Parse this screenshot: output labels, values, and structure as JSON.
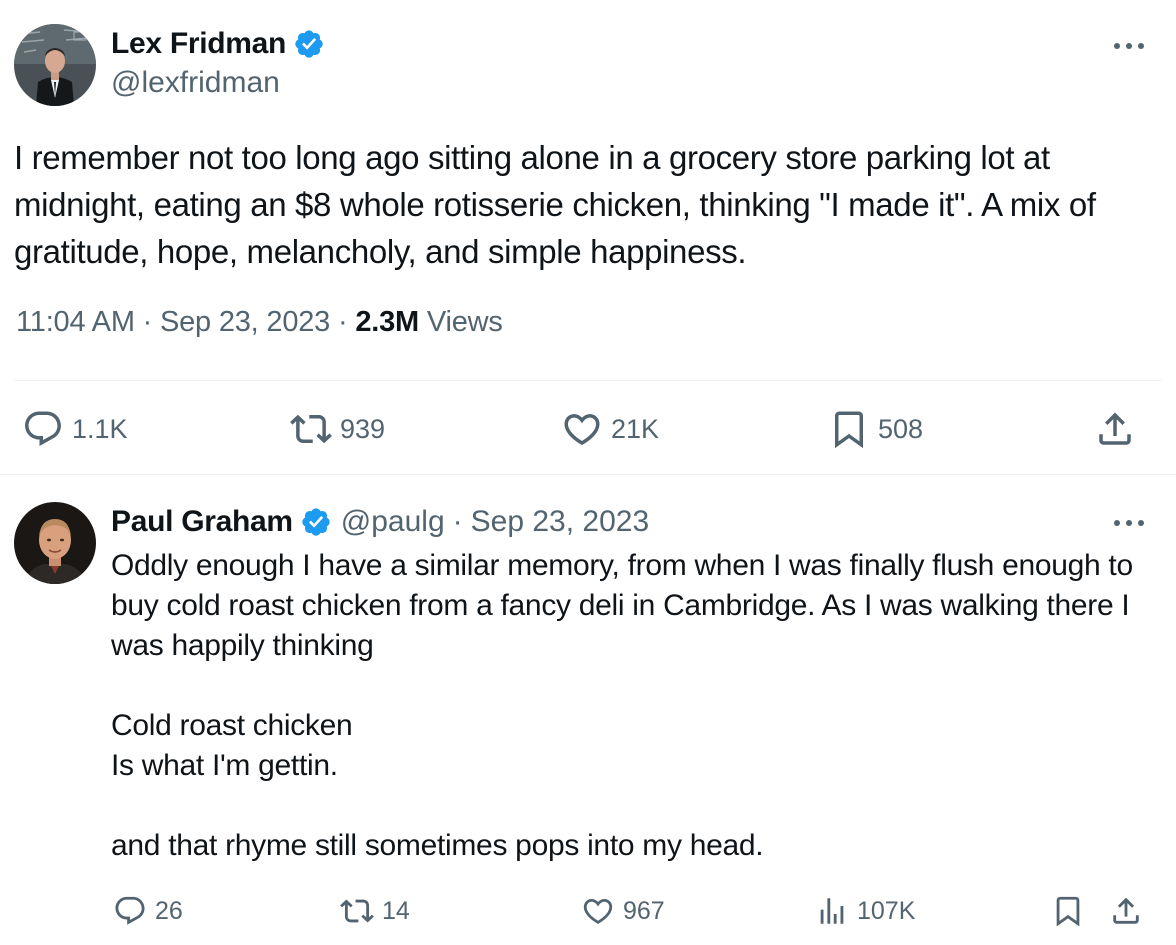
{
  "main_tweet": {
    "author": {
      "name": "Lex Fridman",
      "handle": "@lexfridman",
      "verified": true
    },
    "text": "I remember not too long ago sitting alone in a grocery store parking lot at midnight, eating an $8 whole rotisserie chicken, thinking \"I made it\". A mix of gratitude, hope, melancholy, and simple happiness.",
    "time": "11:04 AM",
    "date": "Sep 23, 2023",
    "views_count": "2.3M",
    "views_label": "Views",
    "separator": "·",
    "actions": {
      "replies": "1.1K",
      "reposts": "939",
      "likes": "21K",
      "bookmarks": "508"
    },
    "icons": [
      "verified-badge-icon",
      "more-icon",
      "reply-icon",
      "repost-icon",
      "like-icon",
      "bookmark-icon",
      "share-icon"
    ]
  },
  "reply_tweet": {
    "author": {
      "name": "Paul Graham",
      "handle": "@paulg",
      "verified": true
    },
    "date": "Sep 23, 2023",
    "separator": "·",
    "text_lines": [
      "Oddly enough I have a similar memory, from when I was finally flush enough to buy cold roast chicken from a fancy deli in Cambridge. As I was walking there I was happily thinking",
      "Cold roast chicken",
      "Is what I'm gettin.",
      "and that rhyme still sometimes pops into my head."
    ],
    "actions": {
      "replies": "26",
      "reposts": "14",
      "likes": "967",
      "views": "107K"
    },
    "icons": [
      "verified-badge-icon",
      "more-icon",
      "reply-icon",
      "repost-icon",
      "like-icon",
      "views-icon",
      "bookmark-icon",
      "share-icon"
    ]
  },
  "colors": {
    "primary_text": "#0f1419",
    "secondary_text": "#536471",
    "verified_blue": "#1d9bf0",
    "divider": "#eff3f4"
  }
}
